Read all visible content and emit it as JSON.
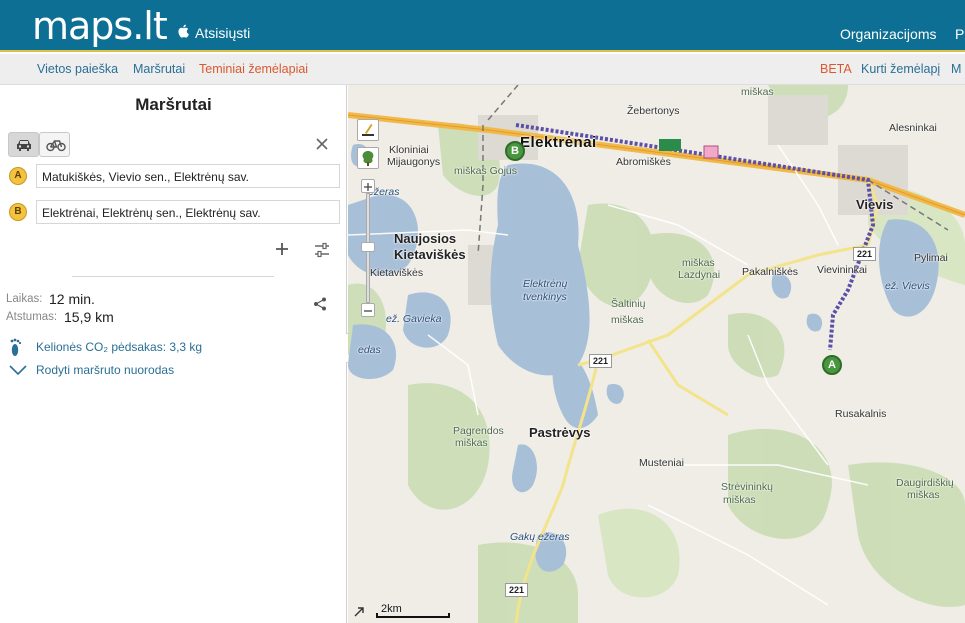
{
  "header": {
    "logo": "maps.lt",
    "download_label": "Atsisiųsti",
    "org_label": "Organizacijoms",
    "org_partial": "P"
  },
  "subnav": {
    "tabs": [
      {
        "label": "Vietos paieška"
      },
      {
        "label": "Maršrutai"
      },
      {
        "label": "Teminiai žemėlapiai",
        "active": true
      }
    ],
    "beta_label": "BETA",
    "create_map_label": "Kurti žemėlapį",
    "more_partial": "M"
  },
  "panel": {
    "title": "Maršrutai",
    "waypoints": [
      {
        "badge": "A",
        "value": "Matukiškės, Vievio sen., Elektrėnų sav."
      },
      {
        "badge": "B",
        "value": "Elektrėnai, Elektrėnų sen., Elektrėnų sav."
      }
    ],
    "time_label": "Laikas:",
    "time_value": "12 min.",
    "distance_label": "Atstumas:",
    "distance_value": "15,9 km",
    "co2_text": "Kelionės CO₂ pėdsakas: 3,3 kg",
    "directions_link": "Rodyti maršruto nuorodas"
  },
  "map": {
    "labels": {
      "zebertonys": "Žebertonys",
      "alesninkai": "Alesninkai",
      "kloniniai": "Kloniniai",
      "mijaugonys": "Mijaugonys",
      "elektrenai": "Elektrėnai",
      "abromiskes": "Abromiškės",
      "vievis": "Vievis",
      "miskas_gojus": "miškas Gojus",
      "ezeras_top": "ežeras",
      "naujosios": "Naujosios",
      "kietaviskes": "Kietaviškės",
      "kietaviskes2": "Kietaviškės",
      "elektrenu_tv1": "Elektrėnų",
      "elektrenu_tv2": "tvenkinys",
      "miskas_lazdynai1": "miškas",
      "miskas_lazdynai2": "Lazdynai",
      "pakalniskes": "Pakalniškės",
      "vievininkai": "Vievininkai",
      "pylimai": "Pylimai",
      "ez_vievis": "ež. Vievis",
      "ez_gavieka": "ež. Gavieka",
      "saltiniu1": "Šaltinių",
      "saltiniu2": "miškas",
      "rusakalnis": "Rusakalnis",
      "pagrendos1": "Pagrendos",
      "pagrendos2": "miškas",
      "pastrevys": "Pastrėvys",
      "musteniai": "Musteniai",
      "streviniku1": "Strėvininkų",
      "streviniku2": "miškas",
      "daugirdiskiu1": "Daugirdiškių",
      "daugirdiskiu2": "miškas",
      "gaku": "Gakų ežeras",
      "miskas_top": "miškas",
      "edas": "edas"
    },
    "road_numbers": {
      "r221a": "221",
      "r221b": "221",
      "r221c": "221"
    },
    "pin_a": "A",
    "pin_b": "B",
    "scale": "2km",
    "route_color": "#5b4fa8"
  }
}
